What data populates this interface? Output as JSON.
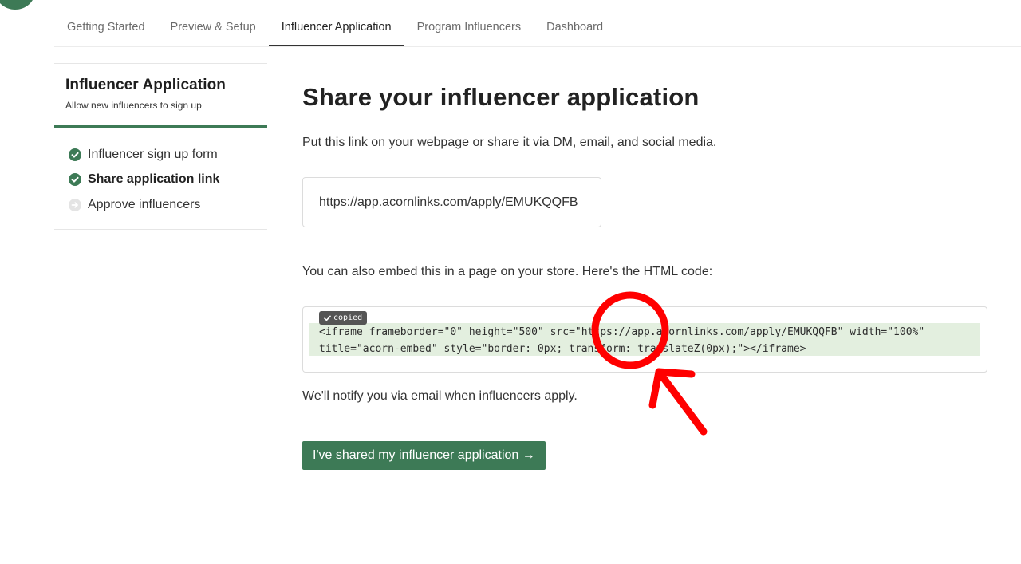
{
  "nav": {
    "tabs": [
      {
        "label": "Getting Started",
        "active": false
      },
      {
        "label": "Preview & Setup",
        "active": false
      },
      {
        "label": "Influencer Application",
        "active": true
      },
      {
        "label": "Program Influencers",
        "active": false
      },
      {
        "label": "Dashboard",
        "active": false
      }
    ]
  },
  "sidebar": {
    "title": "Influencer Application",
    "subtitle": "Allow new influencers to sign up",
    "accent_color": "#3d7a56",
    "steps": [
      {
        "label": "Influencer sign up form",
        "status": "complete",
        "icon": "check-circle-icon"
      },
      {
        "label": "Share application link",
        "status": "complete-current",
        "icon": "check-circle-icon"
      },
      {
        "label": "Approve influencers",
        "status": "pending",
        "icon": "arrow-circle-icon"
      }
    ]
  },
  "main": {
    "title": "Share your influencer application",
    "share_text": "Put this link on your webpage or share it via DM, email, and social media.",
    "application_link": "https://app.acornlinks.com/apply/EMUKQQFB",
    "embed_text": "You can also embed this in a page on your store. Here's the HTML code:",
    "copied_badge": "copied",
    "embed_code_line1": "<iframe frameborder=\"0\" height=\"500\" src=\"https://app.acornlinks.com/apply/EMUKQQFB\" width=\"100%\"",
    "embed_code_line2": "title=\"acorn-embed\" style=\"border: 0px; transform: translateZ(0px);\"></iframe>",
    "notify_text": "We'll notify you via email when influencers apply.",
    "cta_label": "I've shared my influencer application →"
  },
  "annotation": {
    "type": "red circle with arrow",
    "color": "#ff0000"
  }
}
